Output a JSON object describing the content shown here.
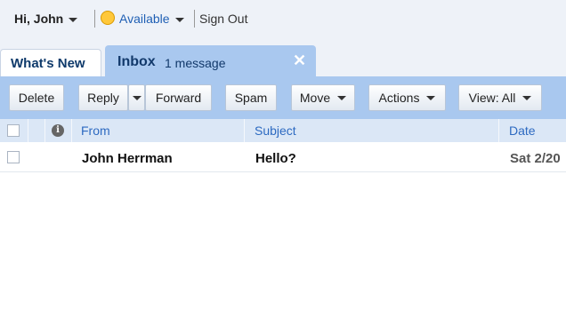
{
  "user": {
    "greeting": "Hi, John",
    "status": "Available",
    "sign_out": "Sign Out"
  },
  "tabs": [
    {
      "label": "What's New"
    },
    {
      "label": "Inbox",
      "count": "1 message",
      "close": "✕"
    }
  ],
  "toolbar": {
    "delete": "Delete",
    "reply": "Reply",
    "forward": "Forward",
    "spam": "Spam",
    "move": "Move",
    "actions": "Actions",
    "view": "View: All"
  },
  "columns": {
    "from": "From",
    "subject": "Subject",
    "date": "Date"
  },
  "messages": [
    {
      "from": "John Herrman",
      "subject": "Hello?",
      "date": "Sat 2/20"
    }
  ],
  "colors": {
    "accent": "#a9c8ef",
    "header_bg": "#dbe7f6",
    "link": "#2d6ac1"
  }
}
